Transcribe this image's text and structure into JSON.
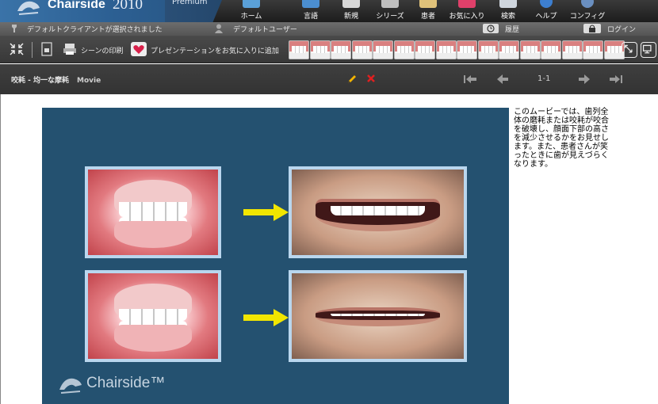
{
  "app": {
    "name": "Chairside",
    "year": "2010",
    "edition": "Premium"
  },
  "nav": [
    {
      "label": "ホーム",
      "icon": "home-icon"
    },
    {
      "label": "言語",
      "icon": "language-icon"
    },
    {
      "label": "新規",
      "icon": "new-icon"
    },
    {
      "label": "シリーズ",
      "icon": "series-icon"
    },
    {
      "label": "患者",
      "icon": "patient-icon"
    },
    {
      "label": "お気に入り",
      "icon": "favorites-icon"
    },
    {
      "label": "検索",
      "icon": "search-icon"
    },
    {
      "label": "ヘルプ",
      "icon": "help-icon"
    },
    {
      "label": "コンフィグ",
      "icon": "config-icon"
    }
  ],
  "status": {
    "client": "デフォルトクライアントが選択されました",
    "user": "デフォルトユーザー",
    "history": "履歴",
    "login": "ログイン"
  },
  "toolbar": {
    "print_scene": "シーンの印刷",
    "add_favorite": "プレゼンテーションをお気に入りに追加",
    "thumbnail_count": 16
  },
  "movie": {
    "title": "咬耗 - 均一な摩耗",
    "type": "Movie",
    "pager": "1-1",
    "brand": "Chairside™"
  },
  "description": "このムービーでは、歯列全体の磨耗または咬耗が咬合を破壊し、顔面下部の高さを減少させるかをお見せします。また、患者さんが笑ったときに歯が見えづらくなります。",
  "colors": {
    "accent": "#2c5f92",
    "frame": "#245170",
    "arrow": "#f2e600",
    "panel_border": "#b9d6ee"
  }
}
